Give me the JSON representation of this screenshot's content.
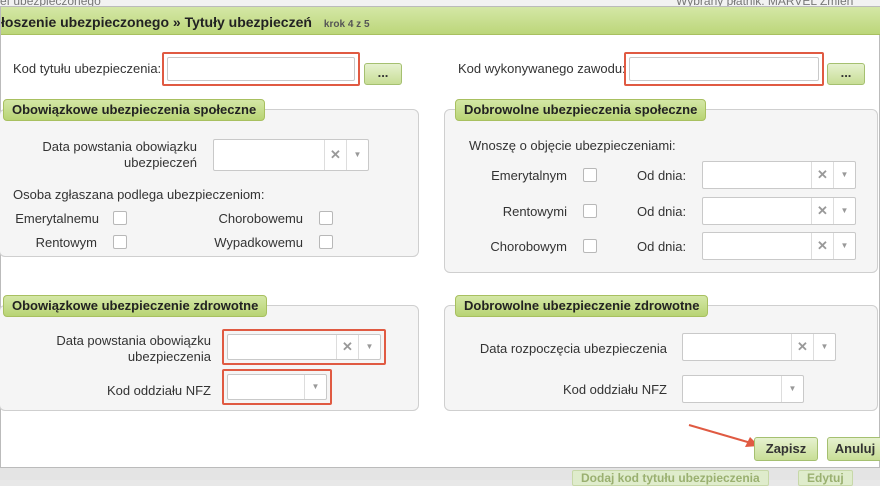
{
  "background": {
    "top_left_text": "ef ubezpieczonego",
    "top_right_text": "Wybrany płatnik: MARVEL  Zmień",
    "bottom_buttons": [
      "Dodaj kod tytułu ubezpieczenia",
      "Edytuj"
    ]
  },
  "dialog": {
    "title": "łoszenie ubezpieczonego » Tytuły ubezpieczeń",
    "step": "krok 4 z 5",
    "kod_tytulu_label": "Kod tytułu ubezpieczenia:",
    "kod_tytulu_value": "",
    "kod_zawodu_label": "Kod wykonywanego zawodu:",
    "kod_zawodu_value": "",
    "lookup_button": "...",
    "clear_glyph": "✕",
    "dropdown_glyph": "▼"
  },
  "oblig_social": {
    "legend": "Obowiązkowe ubezpieczenia społeczne",
    "data_label_line1": "Data powstania obowiązku",
    "data_label_line2": "ubezpieczeń",
    "subject_label": "Osoba zgłaszana podlega ubezpieczeniom:",
    "emerytalne": "Emerytalnemu",
    "rentowe": "Rentowym",
    "chorobowe": "Chorobowemu",
    "wypadkowe": "Wypadkowemu"
  },
  "voluntary_social": {
    "legend": "Dobrowolne ubezpieczenia społeczne",
    "request_label": "Wnoszę o objęcie ubezpieczeniami:",
    "emerytalne": "Emerytalnym",
    "rentowe": "Rentowymi",
    "chorobowe": "Chorobowym",
    "od_dnia": "Od dnia:"
  },
  "oblig_health": {
    "legend": "Obowiązkowe ubezpieczenie zdrowotne",
    "data_label_line1": "Data powstania obowiązku",
    "data_label_line2": "ubezpieczenia",
    "nfz_label": "Kod oddziału NFZ"
  },
  "voluntary_health": {
    "legend": "Dobrowolne ubezpieczenie zdrowotne",
    "start_label": "Data rozpoczęcia ubezpieczenia",
    "nfz_label": "Kod oddziału NFZ"
  },
  "footer": {
    "save": "Zapisz",
    "cancel": "Anuluj"
  },
  "colors": {
    "accent_green": "#bcd67a",
    "highlight_red": "#e05a42"
  }
}
